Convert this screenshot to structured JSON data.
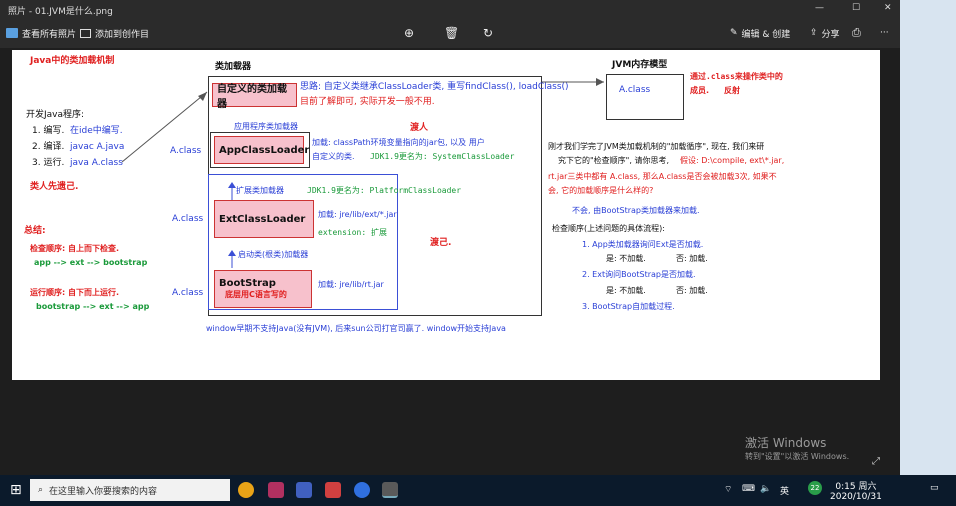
{
  "window": {
    "title": "照片 - 01.JVM是什么.png",
    "controls": {
      "minimize": "—",
      "maximize": "☐",
      "close": "✕"
    }
  },
  "toolbar": {
    "view_all": "查看所有照片",
    "add_to_creation": "添加到创作目",
    "edit_create": "编辑 & 创建",
    "share": "分享",
    "more": "···"
  },
  "slide": {
    "heading": "Java中的类加载机制",
    "dev_title": "开发Java程序:",
    "steps": [
      "1. 编写.",
      "2. 编译.",
      "3. 运行."
    ],
    "step_details": [
      "在ide中编写.",
      "javac  A.java",
      "java A.class"
    ],
    "load_first": "类人先遗己.",
    "summary_title": "总结:",
    "check_order": "检查顺序: 自上而下检查.",
    "check_path": "app --> ext --> bootstrap",
    "run_order": "运行顺序: 自下而上运行.",
    "run_path": "bootstrap --> ext --> app",
    "loader_header": "类加载器",
    "custom_loader": "自定义的类加载器",
    "custom_desc1": "思路: 自定义类继承ClassLoader类, 重写findClass(), loadClass()",
    "custom_desc2": "目前了解即可, 实际开发一般不用.",
    "app_label": "应用程序类加载器",
    "app_loader": "AppClassLoader",
    "app_desc1": "加载: classPath环境变量指向的jar包, 以及 用户",
    "app_desc2": "自定义的类.",
    "app_jdk9": "JDK1.9更名为: SystemClassLoader",
    "recruit": "渡人",
    "ext_label": "扩展类加载器",
    "ext_jdk9": "JDK1.9更名为: PlatformClassLoader",
    "ext_loader": "ExtClassLoader",
    "ext_desc1": "加载: jre/lib/ext/*.jar",
    "ext_desc2": "extension: 扩展",
    "self": "渡己.",
    "boot_label": "启动类(根类)加载器",
    "boot_loader": "BootStrap",
    "boot_note": "底层用C语言写的",
    "boot_desc": "加载: jre/lib/rt.jar",
    "aclass": "A.class",
    "windows_note": "window早期不支持Java(没有JVM), 后来sun公司打官司赢了. window开始支持Java",
    "jvm_model": "JVM内存模型",
    "jvm_aclass": "A.class",
    "jvm_note1": "通过.class来操作类中的",
    "jvm_note2": "成员.",
    "jvm_note3": "反射",
    "q1": "刚才我们学完了JVM类加载机制的\"加载循序\", 现在, 我们来研",
    "q2": "究下它的\"检查顺序\", 请你思考,",
    "q2b": "假设: D:\\compile, ext\\*.jar,",
    "q3": "rt.jar三类中都有 A.class, 那么A.class是否会被加载3次, 如果不",
    "q4": "会, 它的加载顺序是什么样的?",
    "answer": "不会, 由BootStrap类加载器来加载.",
    "flow_title": "检查顺序(上述问题的具体流程):",
    "flow1": "1. App类加载器询问Ext是否加载.",
    "flow1_yes": "是: 不加载.",
    "flow1_no": "否: 加载.",
    "flow2": "2. Ext询问BootStrap是否加载.",
    "flow2_yes": "是: 不加载.",
    "flow2_no": "否: 加载.",
    "flow3": "3. BootStrap自加载过程."
  },
  "watermark": {
    "title": "激活 Windows",
    "subtitle": "转到\"设置\"以激活 Windows."
  },
  "taskbar": {
    "search_placeholder": "在这里输入你要搜索的内容",
    "time": "0:15 周六",
    "date": "2020/10/31",
    "ime": "英",
    "notify_count": "22"
  }
}
